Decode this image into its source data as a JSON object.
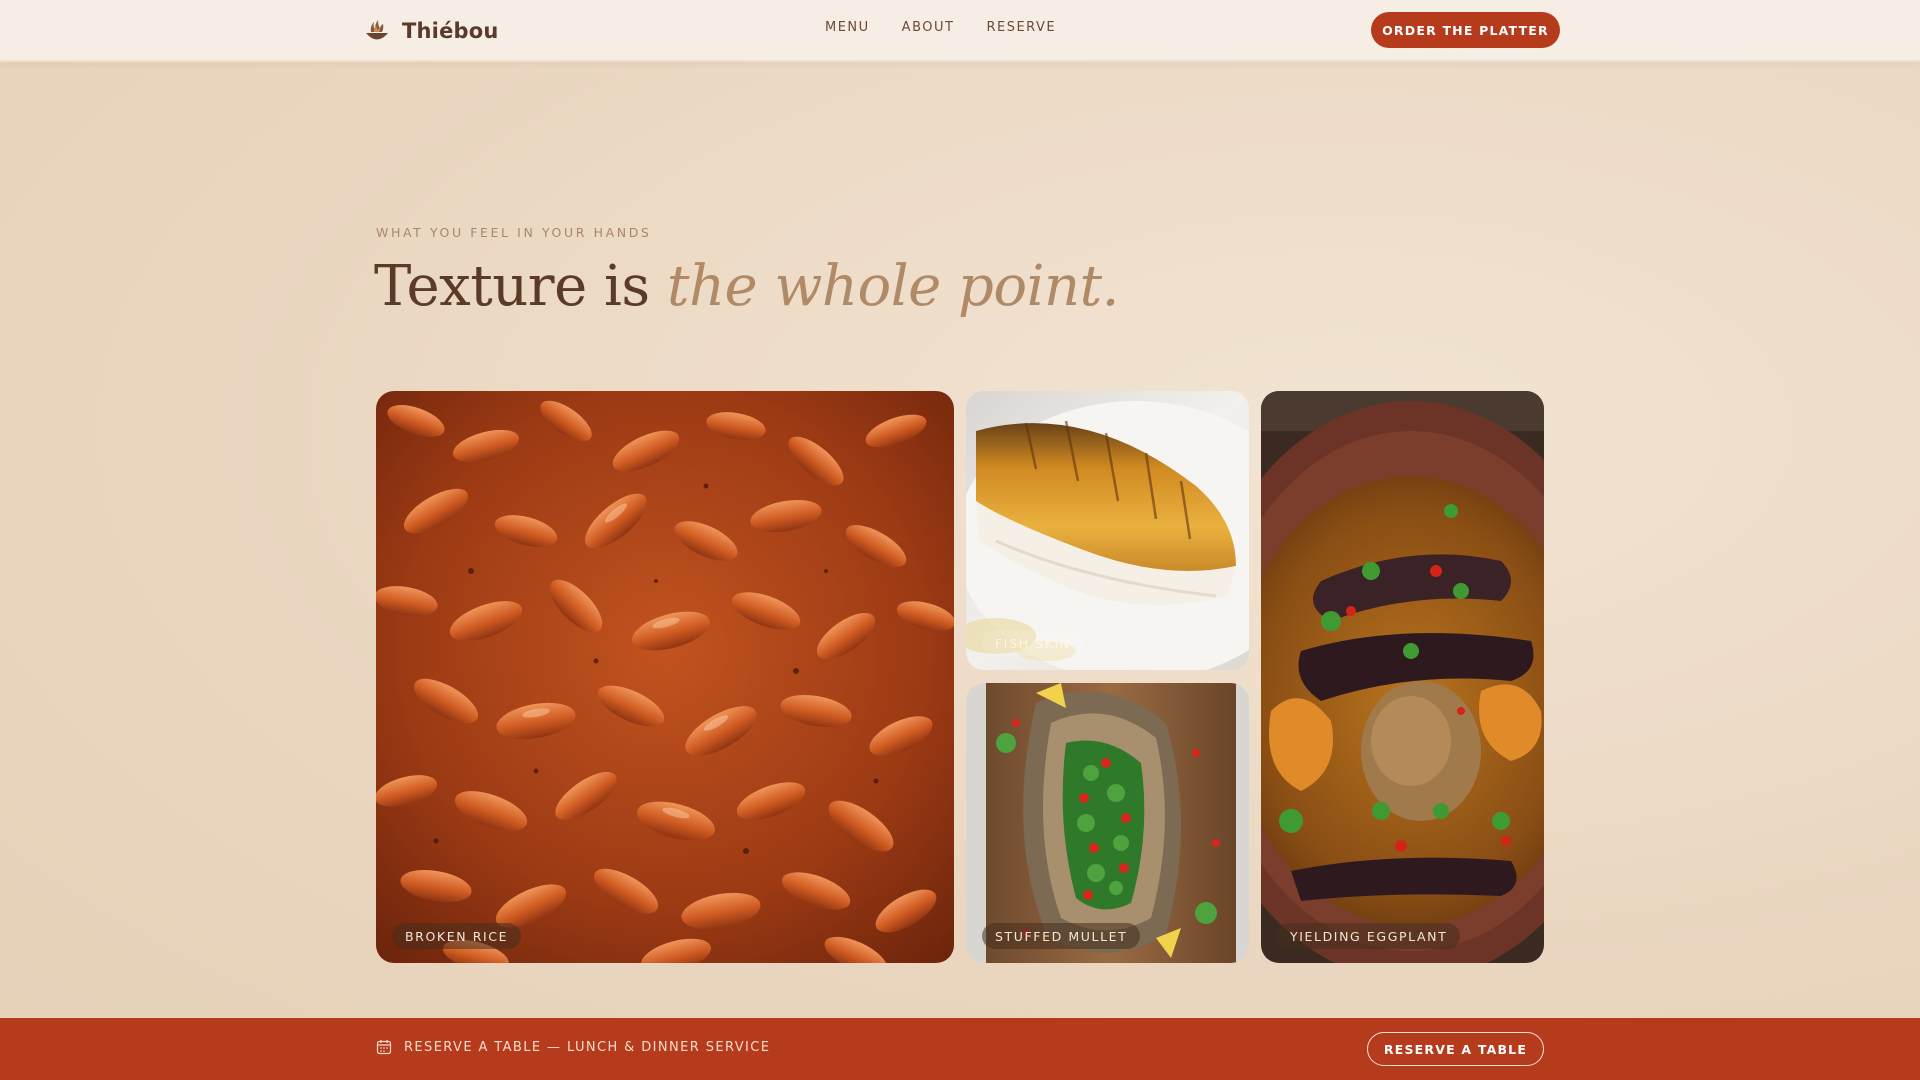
{
  "brand": {
    "name": "Thiébou",
    "icon": "flame-bowl-icon"
  },
  "nav": {
    "items": [
      "MENU",
      "ABOUT",
      "RESERVE"
    ]
  },
  "header": {
    "cta_label": "ORDER THE PLATTER"
  },
  "hero": {
    "eyebrow": "WHAT YOU FEEL IN YOUR HANDS",
    "headline_plain": "Texture is ",
    "headline_italic": "the whole point."
  },
  "gallery": {
    "tiles": [
      {
        "label": "BROKEN RICE"
      },
      {
        "label": "FISH SKIN"
      },
      {
        "label": "STUFFED MULLET"
      },
      {
        "label": "YIELDING EGGPLANT"
      }
    ]
  },
  "footer": {
    "info_icon": "calendar-icon",
    "info_text": "RESERVE A TABLE — LUNCH & DINNER SERVICE",
    "cta_label": "RESERVE A TABLE"
  },
  "colors": {
    "accent": "#b63b1c",
    "background": "#ecd9c3",
    "header_bg": "#f6eee4",
    "text_dark": "#5a3a2a",
    "text_muted": "#b08a66"
  }
}
